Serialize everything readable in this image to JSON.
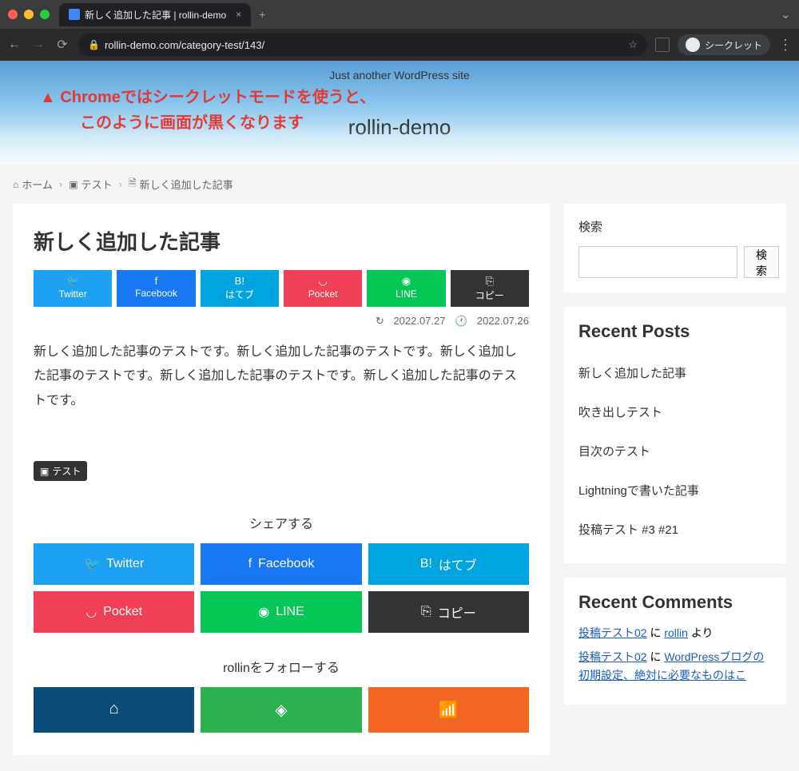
{
  "browser": {
    "tab_title": "新しく追加した記事 | rollin-demo",
    "url": "rollin-demo.com/category-test/143/",
    "incognito_label": "シークレット"
  },
  "header": {
    "tagline": "Just another WordPress site",
    "site_title": "rollin-demo",
    "annotation_line1": "▲ Chromeではシークレットモードを使うと、",
    "annotation_line2": "このように画面が黒くなります"
  },
  "breadcrumb": {
    "home": "ホーム",
    "category": "テスト",
    "current": "新しく追加した記事"
  },
  "article": {
    "title": "新しく追加した記事",
    "date_updated": "2022.07.27",
    "date_published": "2022.07.26",
    "body": "新しく追加した記事のテストです。新しく追加した記事のテストです。新しく追加した記事のテストです。新しく追加した記事のテストです。新しく追加した記事のテストです。",
    "category": "テスト"
  },
  "share_small": {
    "twitter": "Twitter",
    "facebook": "Facebook",
    "hatebu": "はてブ",
    "pocket": "Pocket",
    "line": "LINE",
    "copy": "コピー"
  },
  "share_section_label": "シェアする",
  "share_big": {
    "twitter": "Twitter",
    "facebook": "Facebook",
    "hatebu": "はてブ",
    "pocket": "Pocket",
    "line": "LINE",
    "copy": "コピー"
  },
  "follow_label": "rollinをフォローする",
  "sidebar": {
    "search_title": "検索",
    "search_button": "検索",
    "recent_posts_title": "Recent Posts",
    "recent_posts": [
      "新しく追加した記事",
      "吹き出しテスト",
      "目次のテスト",
      "Lightningで書いた記事",
      "投稿テスト #3 #21"
    ],
    "recent_comments_title": "Recent Comments",
    "comments": [
      {
        "post": "投稿テスト02",
        "mid": " に ",
        "author": "rollin",
        "suffix": " より"
      },
      {
        "post": "投稿テスト02",
        "mid": " に ",
        "author": "WordPressブログの初期設定、絶対に必要なものはこ",
        "suffix": ""
      }
    ]
  }
}
